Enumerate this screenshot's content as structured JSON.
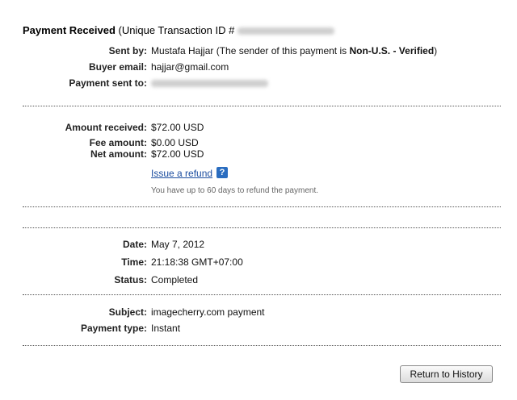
{
  "header": {
    "title_bold": "Payment Received",
    "title_rest": "(Unique Transaction ID #"
  },
  "sender": {
    "sent_by_label": "Sent by:",
    "sent_by_name": "Mustafa Hajjar",
    "sent_by_note_prefix": "(The sender of this payment is",
    "sent_by_status": "Non-U.S. - Verified",
    "sent_by_note_suffix": ")",
    "buyer_email_label": "Buyer email:",
    "buyer_email": "hajjar@gmail.com",
    "payment_sent_to_label": "Payment sent to:"
  },
  "amounts": {
    "received_label": "Amount received:",
    "received": "$72.00 USD",
    "fee_label": "Fee amount:",
    "fee": "$0.00 USD",
    "net_label": "Net amount:",
    "net": "$72.00 USD",
    "refund_link": "Issue a refund",
    "help_icon_glyph": "?",
    "refund_note": "You have up to 60 days to refund the payment."
  },
  "details": {
    "date_label": "Date:",
    "date": "May 7, 2012",
    "time_label": "Time:",
    "time": "21:18:38 GMT+07:00",
    "status_label": "Status:",
    "status": "Completed"
  },
  "purchase": {
    "subject_label": "Subject:",
    "subject": "imagecherry.com payment",
    "payment_type_label": "Payment type:",
    "payment_type": "Instant"
  },
  "actions": {
    "return_button": "Return to History"
  },
  "colors": {
    "link": "#1c4ea0",
    "help_icon_bg": "#2a6dc0",
    "note_text": "#666666"
  }
}
